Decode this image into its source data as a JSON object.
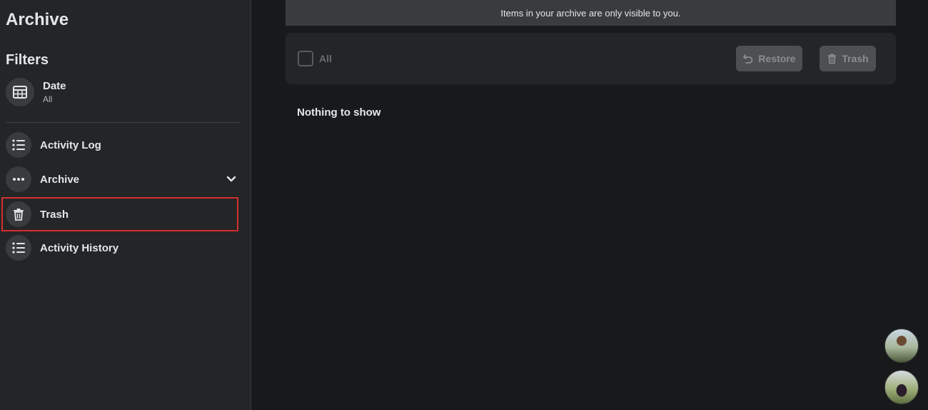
{
  "sidebar": {
    "title": "Archive",
    "filters_title": "Filters",
    "date_filter": {
      "label": "Date",
      "value": "All",
      "icon": "calendar-icon"
    },
    "items": [
      {
        "label": "Activity Log",
        "icon": "list-icon"
      },
      {
        "label": "Archive",
        "icon": "more-horizontal-icon",
        "expand_icon": "chevron-down-icon"
      },
      {
        "label": "Trash",
        "icon": "trash-icon",
        "highlighted": true
      },
      {
        "label": "Activity History",
        "icon": "list-icon"
      }
    ]
  },
  "main": {
    "banner_text": "Items in your archive are only visible to you.",
    "toolbar": {
      "select_all_label": "All",
      "restore_label": "Restore",
      "trash_label": "Trash"
    },
    "empty_text": "Nothing to show"
  },
  "colors": {
    "background": "#18191a",
    "panel": "#242526",
    "highlight_border": "#d32f2f"
  }
}
